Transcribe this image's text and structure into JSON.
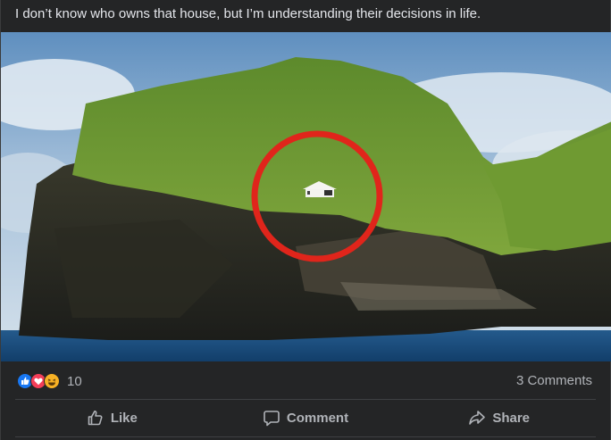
{
  "post": {
    "caption": "I don’t know who owns that house, but I’m understanding their decisions in life.",
    "photo_alt": "Photo"
  },
  "stats": {
    "reaction_icons": [
      "like-icon",
      "love-icon",
      "haha-icon"
    ],
    "reaction_count": "10",
    "comments": "3 Comments"
  },
  "actions": {
    "like": "Like",
    "comment": "Comment",
    "share": "Share"
  },
  "colors": {
    "background": "#242526",
    "text": "#e4e6eb",
    "secondary_text": "#b0b3b8",
    "like_blue": "#1877f2",
    "love_red": "#f33e58",
    "haha_yellow": "#f7b125",
    "highlight_circle": "#e0251b"
  }
}
